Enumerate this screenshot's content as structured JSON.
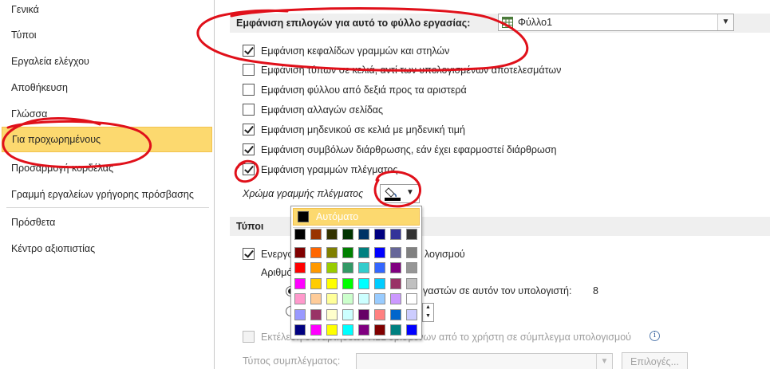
{
  "sidebar": {
    "items": [
      {
        "label": "Γενικά"
      },
      {
        "label": "Τύποι"
      },
      {
        "label": "Εργαλεία ελέγχου"
      },
      {
        "label": "Αποθήκευση"
      },
      {
        "label": "Γλώσσα"
      },
      {
        "label": "Για προχωρημένους",
        "selected": true
      },
      {
        "label": "Προσαρμογή κορδέλας"
      },
      {
        "label": "Γραμμή εργαλείων γρήγορης πρόσβασης"
      },
      {
        "label": "Πρόσθετα"
      },
      {
        "label": "Κέντρο αξιοπιστίας"
      }
    ]
  },
  "sheet_section": {
    "header": "Εμφάνιση επιλογών για αυτό το φύλλο εργασίας:",
    "sheet_value": "Φύλλο1",
    "options": [
      {
        "label": "Εμφάνιση κεφαλίδων γραμμών και στηλών",
        "checked": true
      },
      {
        "label": "Εμφάνιση τύπων σε κελιά, αντί των υπολογισμένων αποτελεσμάτων",
        "checked": false
      },
      {
        "label": "Εμφάνιση φύλλου από δεξιά προς τα αριστερά",
        "checked": false
      },
      {
        "label": "Εμφάνιση αλλαγών σελίδας",
        "checked": false
      },
      {
        "label": "Εμφάνιση μηδενικού σε κελιά με μηδενική τιμή",
        "checked": true
      },
      {
        "label": "Εμφάνιση συμβόλων διάρθρωσης, εάν έχει εφαρμοστεί διάρθρωση",
        "checked": true
      },
      {
        "label": "Εμφάνιση γραμμών πλέγματος",
        "checked": true
      }
    ],
    "gridline_color_label": "Χρώμα γραμμής πλέγματος"
  },
  "palette": {
    "auto_label": "Αυτόματο",
    "rows": [
      [
        "#000000",
        "#993300",
        "#333300",
        "#003300",
        "#003366",
        "#000080",
        "#333399",
        "#333333"
      ],
      [
        "#800000",
        "#FF6600",
        "#808000",
        "#008000",
        "#008080",
        "#0000FF",
        "#666699",
        "#808080"
      ],
      [
        "#FF0000",
        "#FF9900",
        "#99CC00",
        "#339966",
        "#33CCCC",
        "#3366FF",
        "#800080",
        "#969696"
      ],
      [
        "#FF00FF",
        "#FFCC00",
        "#FFFF00",
        "#00FF00",
        "#00FFFF",
        "#00CCFF",
        "#993366",
        "#C0C0C0"
      ],
      [
        "#FF99CC",
        "#FFCC99",
        "#FFFF99",
        "#CCFFCC",
        "#CCFFFF",
        "#99CCFF",
        "#CC99FF",
        "#FFFFFF"
      ],
      [
        "#9999FF",
        "#993366",
        "#FFFFCC",
        "#CCFFFF",
        "#660066",
        "#FF8080",
        "#0066CC",
        "#CCCCFF"
      ],
      [
        "#000080",
        "#FF00FF",
        "#FFFF00",
        "#00FFFF",
        "#800080",
        "#800000",
        "#008080",
        "#0000FF"
      ]
    ]
  },
  "formulas_section": {
    "header": "Τύποι",
    "multithread_label_start": "Ενεργο",
    "multithread_label_end": "λογισμού",
    "threads_label_start": "Αριθμό",
    "threads_all_label": "γαστών σε αυτόν τον υπολογιστή:",
    "threads_count": "8",
    "xll_label": "Εκτέλεση συναρτήσεων XLL ορισμένων από το χρήστη σε σύμπλεγμα υπολογισμού",
    "info_icon": "i",
    "cluster_type_label": "Τύπος συμπλέγματος:",
    "options_button": "Επιλογές..."
  },
  "colors": {
    "selected": "#fcd96f",
    "annotation": "#e0101a"
  }
}
